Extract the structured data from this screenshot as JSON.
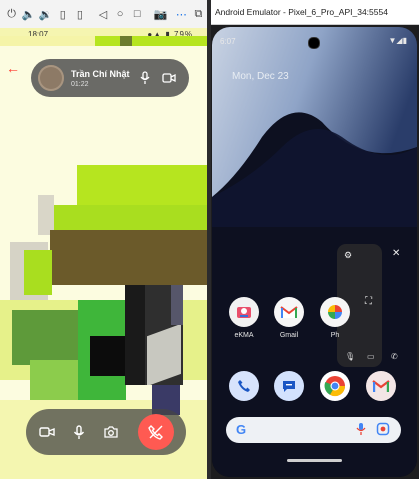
{
  "left_phone": {
    "status_time": "18:07",
    "status_right": "●▲ ▮ 79%",
    "call": {
      "name": "Trần Chí Nhật",
      "duration": "01:22"
    }
  },
  "emulator": {
    "window_title": "Android Emulator - Pixel_6_Pro_API_34:5554",
    "status_time": "6:07",
    "date": "Mon, Dec 23",
    "apps": {
      "ekma": "eKMA",
      "gmail": "Gmail",
      "photos": "Ph"
    }
  },
  "colors": {
    "end_call": "#ff5a52",
    "back_arrow": "#ff3b30",
    "lime": "#b6e51f",
    "olive": "#6b5a2a"
  }
}
